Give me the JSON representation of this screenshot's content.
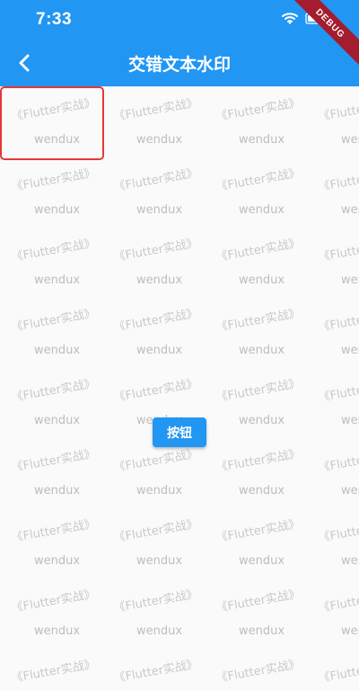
{
  "status_bar": {
    "time": "7:33",
    "icons": [
      "wifi-icon",
      "battery-icon"
    ],
    "debug_ribbon": "DEBUG"
  },
  "app_bar": {
    "title": "交错文本水印",
    "back_icon": "chevron-left-icon",
    "background_color": "#2196f3"
  },
  "watermark": {
    "line1": "《Flutter实战》",
    "line2": "wendux",
    "text_color": "#c9c9c9"
  },
  "highlight_color": "#e53935",
  "button": {
    "label": "按钮",
    "color": "#2196f3"
  }
}
